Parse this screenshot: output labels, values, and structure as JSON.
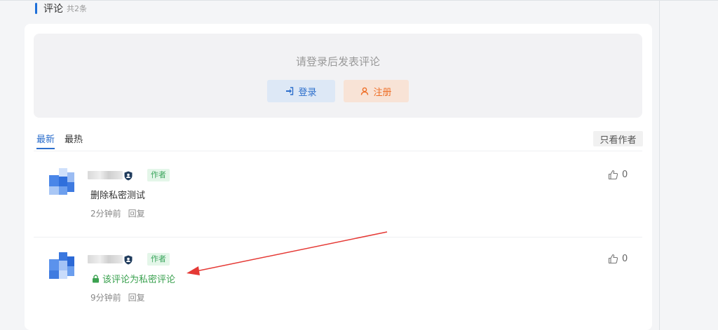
{
  "header": {
    "title": "评论",
    "count": "共2条"
  },
  "login": {
    "prompt": "请登录后发表评论",
    "login_label": "登录",
    "register_label": "注册"
  },
  "tabs": [
    {
      "label": "最新",
      "active": true
    },
    {
      "label": "最热",
      "active": false
    }
  ],
  "filter": {
    "author_only_label": "只看作者"
  },
  "comments": [
    {
      "author_tag": "作者",
      "content": "删除私密测试",
      "time": "2分钟前",
      "reply_label": "回复",
      "likes": "0"
    },
    {
      "author_tag": "作者",
      "private_notice": "该评论为私密评论",
      "time": "9分钟前",
      "reply_label": "回复",
      "likes": "0"
    }
  ],
  "colors": {
    "accent": "#2d6fcc",
    "register": "#ee6d25",
    "author_tag": "#3ba55d",
    "annotation_arrow": "#e53935"
  },
  "icons": {
    "login": "sign-in-icon",
    "register": "user-icon",
    "like": "thumbs-up-icon",
    "private": "lock-icon",
    "badge": "shield-user-icon"
  }
}
